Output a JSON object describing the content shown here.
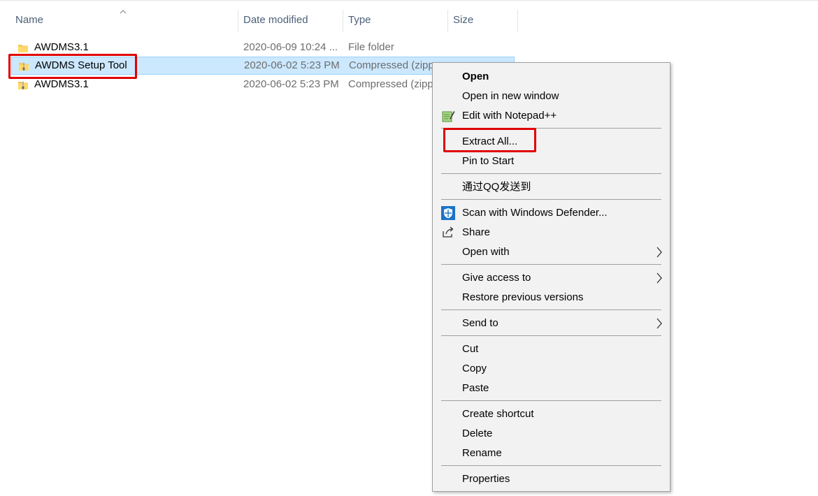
{
  "columns": {
    "name": "Name",
    "date": "Date modified",
    "type": "Type",
    "size": "Size",
    "sort_icon": "chevron-up-icon"
  },
  "files": [
    {
      "name": "AWDMS3.1",
      "date": "2020-06-09 10:24 ...",
      "type": "File folder",
      "icon": "folder-icon"
    },
    {
      "name": "AWDMS Setup Tool",
      "date": "2020-06-02 5:23 PM",
      "type": "Compressed (zipp",
      "icon": "zip-folder-icon",
      "selected": true
    },
    {
      "name": "AWDMS3.1",
      "date": "2020-06-02 5:23 PM",
      "type": "Compressed (zipp",
      "icon": "zip-folder-icon"
    }
  ],
  "context_menu": {
    "open": "Open",
    "open_new_window": "Open in new window",
    "edit_notepad": "Edit with Notepad++",
    "extract_all": "Extract All...",
    "pin_start": "Pin to Start",
    "send_qq": "通过QQ发送到",
    "scan_defender": "Scan with Windows Defender...",
    "share": "Share",
    "open_with": "Open with",
    "give_access": "Give access to",
    "restore_versions": "Restore previous versions",
    "send_to": "Send to",
    "cut": "Cut",
    "copy": "Copy",
    "paste": "Paste",
    "create_shortcut": "Create shortcut",
    "delete": "Delete",
    "rename": "Rename",
    "properties": "Properties"
  },
  "colors": {
    "selection": "#cce8ff",
    "highlight_box": "#e00000",
    "menu_bg": "#f2f2f2"
  }
}
